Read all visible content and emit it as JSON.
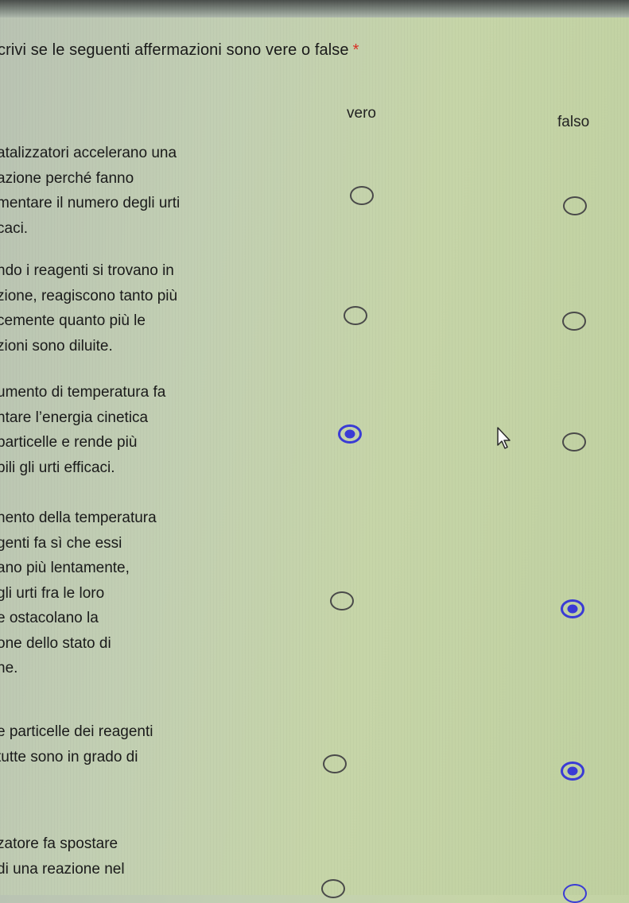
{
  "question": {
    "text": "crivi se le seguenti affermazioni sono vere o false",
    "required_mark": "*"
  },
  "columns": {
    "vero": "vero",
    "falso": "falso"
  },
  "rows": [
    {
      "lines": [
        "atalizzatori accelerano una",
        "azione perché fanno",
        "mentare il numero degli urti",
        "caci."
      ],
      "selected": "none"
    },
    {
      "lines": [
        "ndo i reagenti si trovano in",
        "zione, reagiscono tanto più",
        "cemente quanto più le",
        "zioni sono diluite."
      ],
      "selected": "none"
    },
    {
      "lines": [
        "umento di temperatura fa",
        "ntare l’energia cinetica",
        "particelle e rende più",
        "bili gli urti efficaci."
      ],
      "selected": "vero"
    },
    {
      "lines": [
        "nento della temperatura",
        "genti fa sì che essi",
        "ano più lentamente,",
        "gli urti fra le loro",
        "e ostacolano la",
        "one dello stato di",
        "ne."
      ],
      "selected": "falso"
    },
    {
      "lines": [
        "e particelle dei reagenti",
        "tutte sono in grado di"
      ],
      "selected": "falso"
    },
    {
      "lines": [
        "zatore fa spostare",
        "di una reazione nel"
      ],
      "selected": "none"
    }
  ],
  "colors": {
    "accent": "#3a3bd6",
    "required": "#d93025",
    "radio_border": "#4a4a4a"
  }
}
